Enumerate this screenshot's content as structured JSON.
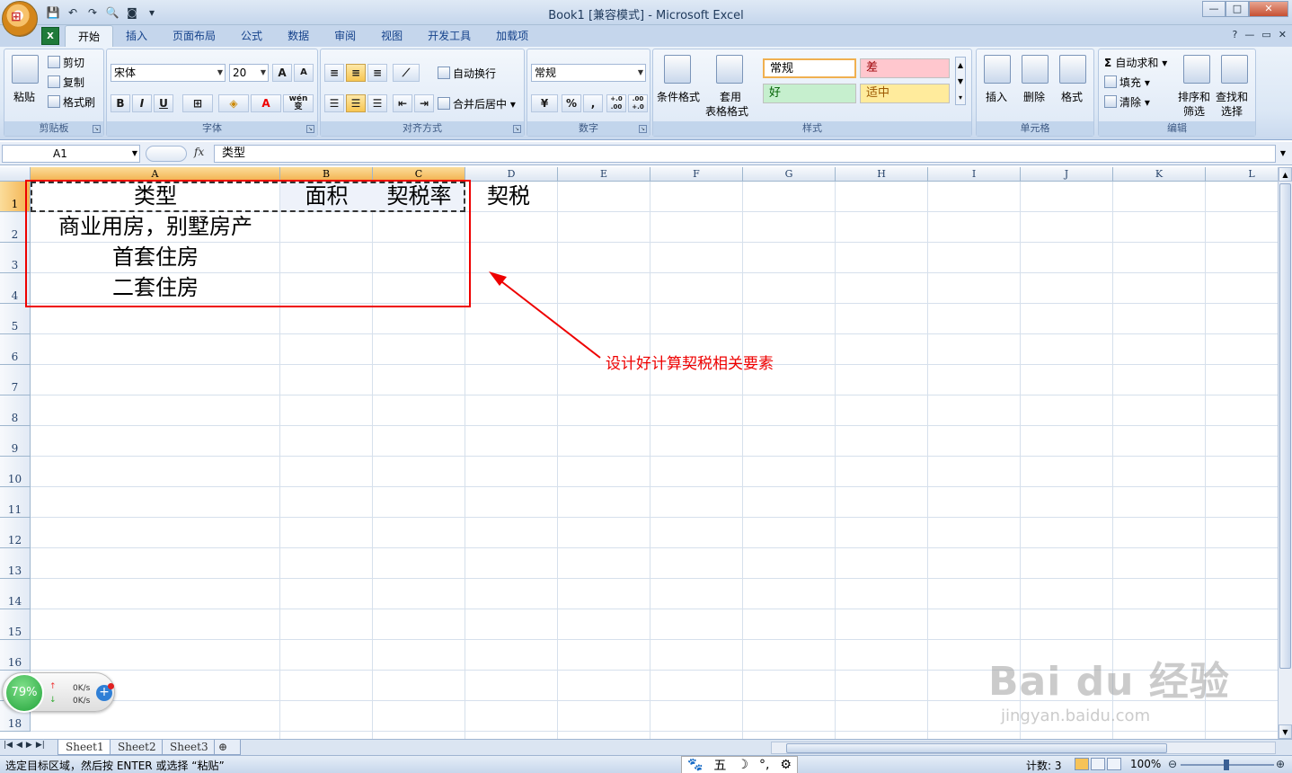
{
  "window": {
    "title": "Book1  [兼容模式] - Microsoft Excel",
    "office_logo": "office-logo",
    "controls": [
      "—",
      "□",
      "✕"
    ]
  },
  "ribbon_tabs": [
    "开始",
    "插入",
    "页面布局",
    "公式",
    "数据",
    "审阅",
    "视图",
    "开发工具",
    "加载项"
  ],
  "active_tab": "开始",
  "ribbon": {
    "clipboard": {
      "title": "剪贴板",
      "paste": "粘贴",
      "cut": "剪切",
      "copy": "复制",
      "format_painter": "格式刷"
    },
    "font": {
      "title": "字体",
      "name": "宋体",
      "size": "20",
      "grow": "A",
      "shrink": "A",
      "bold": "B",
      "italic": "I",
      "underline": "U",
      "color_a": "A",
      "phonetic": "wén 变"
    },
    "alignment": {
      "title": "对齐方式",
      "wrap": "自动换行",
      "merge": "合并后居中"
    },
    "number": {
      "title": "数字",
      "format": "常规",
      "percent": "%",
      "comma": ",",
      "inc_dec": "+.0 .00",
      "dec_dec": ".00 +.0"
    },
    "styles": {
      "title": "样式",
      "conditional": "条件格式",
      "table_line1": "套用",
      "table_line2": "表格格式",
      "normal": "常规",
      "bad": "差",
      "good": "好",
      "neutral": "适中"
    },
    "cells": {
      "title": "单元格",
      "insert": "插入",
      "delete": "删除",
      "format": "格式"
    },
    "editing": {
      "title": "编辑",
      "autosum": "自动求和",
      "fill": "填充",
      "clear": "清除",
      "sort_line1": "排序和",
      "sort_line2": "筛选",
      "find_line1": "查找和",
      "find_line2": "选择"
    }
  },
  "formula_bar": {
    "name_box": "A1",
    "fx": "fx",
    "content": "类型"
  },
  "grid": {
    "columns": [
      "A",
      "B",
      "C",
      "D",
      "E",
      "F",
      "G",
      "H",
      "I",
      "J",
      "K",
      "L"
    ],
    "rows": [
      "1",
      "2",
      "3",
      "4",
      "5",
      "6",
      "7",
      "8",
      "9",
      "10",
      "11",
      "12",
      "13",
      "14",
      "15",
      "16",
      "17",
      "18"
    ],
    "cells": {
      "A1": "类型",
      "B1": "面积",
      "C1": "契税率",
      "D1": "契税",
      "A2": "商业用房，别墅房产",
      "A3": "首套住房",
      "A4": "二套住房"
    }
  },
  "annotation": {
    "text": "设计好计算契税相关要素",
    "color": "#e00000"
  },
  "sheets": [
    "Sheet1",
    "Sheet2",
    "Sheet3"
  ],
  "active_sheet": "Sheet1",
  "status": {
    "message": "选定目标区域，然后按 ENTER 或选择 “粘贴”",
    "count": "计数: 3",
    "zoom": "100%"
  },
  "ime_toolbar": [
    "🐾",
    "五",
    "☽",
    "°,",
    "⚙"
  ],
  "net_widget": {
    "percent": "79%",
    "up": "0K/s",
    "down": "0K/s"
  },
  "watermark": {
    "brand": "Bai du 经验",
    "url": "jingyan.baidu.com"
  }
}
